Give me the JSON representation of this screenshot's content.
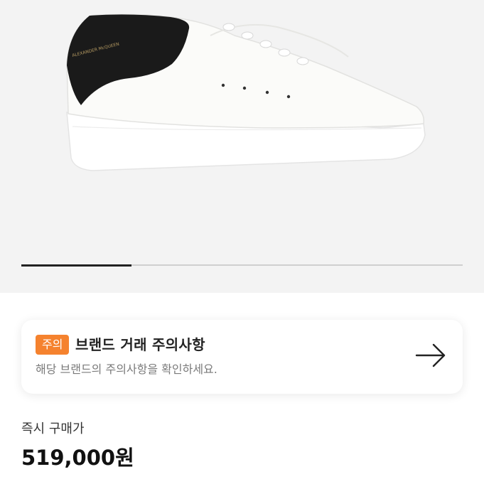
{
  "product": {
    "image": {
      "icon": "sneaker-image",
      "logo_text": "ALEXANDER McQUEEN",
      "colors": {
        "background": "#f3f3f3",
        "heel": "#1a1a1a",
        "body": "#fbfbf9"
      }
    },
    "carousel": {
      "progress": 0.25,
      "active_color": "#222222",
      "track_color": "#cfcfcf"
    }
  },
  "notice": {
    "badge": "주의",
    "badge_color": "#f5822e",
    "title": "브랜드 거래 주의사항",
    "subtitle": "해당 브랜드의 주의사항을 확인하세요.",
    "icon": "arrow-right-icon"
  },
  "price": {
    "label": "즉시 구매가",
    "value": "519,000원"
  }
}
